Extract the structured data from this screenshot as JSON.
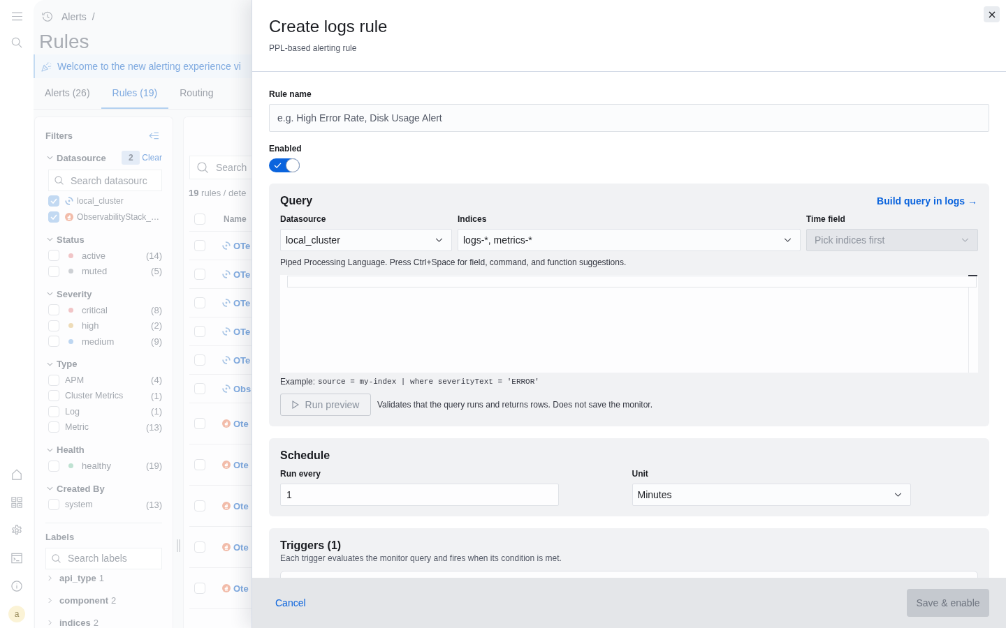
{
  "nav_rail": {
    "avatar": "a"
  },
  "breadcrumb": {
    "label": "Alerts",
    "separator": "/"
  },
  "page_title": "Rules",
  "callout": {
    "text": "Welcome to the new alerting experience vi"
  },
  "tabs": [
    {
      "label": "Alerts (26)",
      "selected": false
    },
    {
      "label": "Rules (19)",
      "selected": true
    },
    {
      "label": "Routing",
      "selected": false
    }
  ],
  "filters": {
    "title": "Filters",
    "groups": [
      {
        "title": "Datasource",
        "expanded": true,
        "count": "2",
        "clear": "Clear",
        "search_placeholder": "Search datasourc",
        "items": [
          {
            "kind": "swirl",
            "label": "local_cluster",
            "checked": true
          },
          {
            "kind": "flame",
            "label": "ObservabilityStack_…",
            "checked": true
          }
        ]
      },
      {
        "title": "Status",
        "expanded": true,
        "items": [
          {
            "kind": "dot",
            "label": "active",
            "count": "(14)",
            "color": "#f1c5c7",
            "checked": false
          },
          {
            "kind": "dot",
            "label": "muted",
            "count": "(5)",
            "color": "#cdd0d4",
            "checked": false
          }
        ]
      },
      {
        "title": "Severity",
        "expanded": true,
        "items": [
          {
            "kind": "dot",
            "label": "critical",
            "count": "(8)",
            "color": "#f1c5c7",
            "checked": false
          },
          {
            "kind": "dot",
            "label": "high",
            "count": "(2)",
            "color": "#eedcb8",
            "checked": false
          },
          {
            "kind": "dot",
            "label": "medium",
            "count": "(9)",
            "color": "#bdd6f1",
            "checked": false
          }
        ]
      },
      {
        "title": "Type",
        "expanded": true,
        "items": [
          {
            "kind": "plain",
            "label": "APM",
            "count": "(4)",
            "checked": false
          },
          {
            "kind": "plain",
            "label": "Cluster Metrics",
            "count": "(1)",
            "checked": false
          },
          {
            "kind": "plain",
            "label": "Log",
            "count": "(1)",
            "checked": false
          },
          {
            "kind": "plain",
            "label": "Metric",
            "count": "(13)",
            "checked": false
          }
        ]
      },
      {
        "title": "Health",
        "expanded": true,
        "items": [
          {
            "kind": "dot",
            "label": "healthy",
            "count": "(19)",
            "color": "#bfe2d2",
            "checked": false
          }
        ]
      },
      {
        "title": "Created By",
        "expanded": true,
        "items": [
          {
            "kind": "plain",
            "label": "system",
            "count": "(13)",
            "checked": false
          }
        ]
      }
    ],
    "labels": {
      "title": "Labels",
      "search_placeholder": "Search labels",
      "items": [
        {
          "name": "api_type",
          "count": "1",
          "expanded": false
        },
        {
          "name": "component",
          "count": "2",
          "expanded": false
        },
        {
          "name": "indices",
          "count": "2",
          "expanded": false
        }
      ]
    }
  },
  "rules_table": {
    "search_placeholder": "Search",
    "summary": "**19** rules / dete",
    "header": {
      "label": "Name",
      "checked": false
    },
    "rows": [
      {
        "kind": "swirl",
        "name": "OTe",
        "checked": false
      },
      {
        "kind": "swirl",
        "name": "OTe",
        "checked": false
      },
      {
        "kind": "swirl",
        "name": "OTe",
        "checked": false
      },
      {
        "kind": "swirl",
        "name": "OTe",
        "checked": false
      },
      {
        "kind": "swirl",
        "name": "OTe",
        "checked": false
      },
      {
        "kind": "swirl",
        "name": "Obs",
        "checked": false
      },
      {
        "kind": "flame",
        "name": "Ote",
        "checked": false
      },
      {
        "kind": "flame",
        "name": "Ote",
        "checked": false
      },
      {
        "kind": "flame",
        "name": "Ote",
        "checked": false
      },
      {
        "kind": "flame",
        "name": "Ote",
        "checked": false
      },
      {
        "kind": "flame",
        "name": "Ote",
        "checked": false
      }
    ]
  },
  "flyout": {
    "title": "Create logs rule",
    "subtitle": "PPL-based alerting rule",
    "rule_name": {
      "label": "Rule name",
      "placeholder": "e.g. High Error Rate, Disk Usage Alert"
    },
    "enabled": {
      "label": "Enabled",
      "on": true
    },
    "query": {
      "title": "Query",
      "link": "Build query in logs →",
      "fields": [
        {
          "label": "Datasource",
          "value": "local_cluster",
          "disabled": false
        },
        {
          "label": "Indices",
          "value": "logs-*, metrics-*",
          "disabled": false
        },
        {
          "label": "Time field",
          "placeholder": "Pick indices first",
          "disabled": true
        }
      ],
      "help": "Piped Processing Language. Press Ctrl+Space for field, command, and function suggestions.",
      "example_label": "Example:",
      "example_code": "source = my-index | where severityText = 'ERROR'",
      "run_preview": {
        "label": "Run preview",
        "disabled": true
      },
      "run_note": "Validates that the query runs and returns rows. Does not save the monitor."
    },
    "schedule": {
      "title": "Schedule",
      "fields": [
        {
          "kind": "input",
          "label": "Run every",
          "value": "1"
        },
        {
          "kind": "select",
          "label": "Unit",
          "value": "Minutes"
        }
      ]
    },
    "triggers": {
      "title": "Triggers (1)",
      "description": "Each trigger evaluates the monitor query and fires when its condition is met."
    }
  },
  "footer": {
    "cancel": "Cancel",
    "save": {
      "label": "Save & enable",
      "disabled": true
    }
  }
}
